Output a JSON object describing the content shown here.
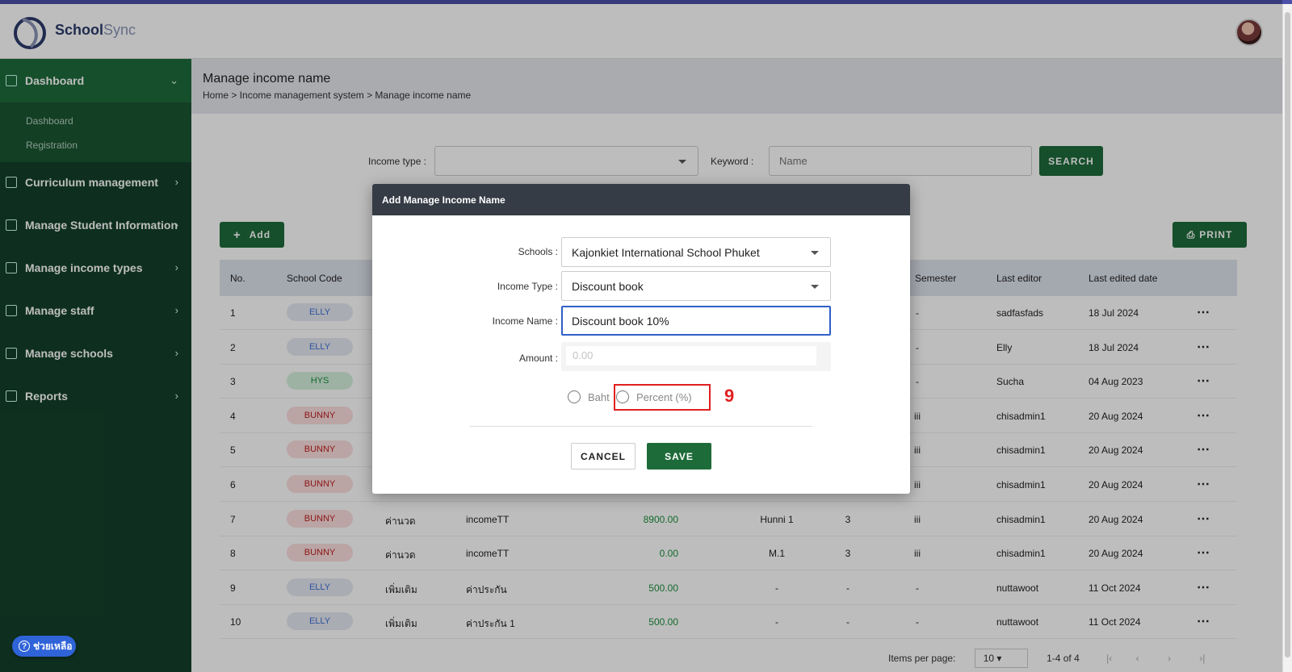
{
  "app": {
    "brand_main": "School",
    "brand_accent": "Sync"
  },
  "sidebar": {
    "items": [
      {
        "label": "Dashboard",
        "icon": "grid-icon"
      },
      {
        "label": "Curriculum management",
        "icon": "graduation-cap-icon"
      },
      {
        "label": "Manage Student Information",
        "icon": "student-icon"
      },
      {
        "label": "Manage income types",
        "icon": "money-hand-icon"
      },
      {
        "label": "Manage staff",
        "icon": "id-card-icon"
      },
      {
        "label": "Manage schools",
        "icon": "school-icon"
      },
      {
        "label": "Reports",
        "icon": "report-icon"
      }
    ],
    "sub_items": [
      "Dashboard",
      "Registration"
    ]
  },
  "page": {
    "title": "Manage income name",
    "breadcrumb": "Home > Income management system > Manage income name"
  },
  "filters": {
    "income_type_label": "Income type :",
    "keyword_label": "Keyword :",
    "keyword_placeholder": "Name",
    "search_label": "SEARCH"
  },
  "toolbar": {
    "add_label": "Add",
    "print_label": "PRINT"
  },
  "table": {
    "headers": {
      "no": "No.",
      "school_code": "School Code",
      "semester": "Semester",
      "last_editor": "Last editor",
      "last_edited_date": "Last edited date"
    },
    "rows": [
      {
        "no": "1",
        "code": "ELLY",
        "c3": "",
        "c4": "",
        "amount": "",
        "c6": "",
        "c7": "",
        "semester": "-",
        "editor": "sadfasfads",
        "date": "18 Jul 2024"
      },
      {
        "no": "2",
        "code": "ELLY",
        "c3": "",
        "c4": "",
        "amount": "",
        "c6": "",
        "c7": "",
        "semester": "-",
        "editor": "Elly",
        "date": "18 Jul 2024"
      },
      {
        "no": "3",
        "code": "HYS",
        "c3": "",
        "c4": "",
        "amount": "",
        "c6": "",
        "c7": "",
        "semester": "-",
        "editor": "Sucha",
        "date": "04 Aug 2023"
      },
      {
        "no": "4",
        "code": "BUNNY",
        "c3": "",
        "c4": "",
        "amount": "",
        "c6": "",
        "c7": "",
        "semester": "iii",
        "editor": "chisadmin1",
        "date": "20 Aug 2024"
      },
      {
        "no": "5",
        "code": "BUNNY",
        "c3": "",
        "c4": "",
        "amount": "",
        "c6": "",
        "c7": "",
        "semester": "iii",
        "editor": "chisadmin1",
        "date": "20 Aug 2024"
      },
      {
        "no": "6",
        "code": "BUNNY",
        "c3": "",
        "c4": "",
        "amount": "",
        "c6": "",
        "c7": "",
        "semester": "iii",
        "editor": "chisadmin1",
        "date": "20 Aug 2024"
      },
      {
        "no": "7",
        "code": "BUNNY",
        "c3": "ค่านวด",
        "c4": "incomeTT",
        "amount": "8900.00",
        "c6": "Hunni 1",
        "c7": "3",
        "semester": "iii",
        "editor": "chisadmin1",
        "date": "20 Aug 2024"
      },
      {
        "no": "8",
        "code": "BUNNY",
        "c3": "ค่านวด",
        "c4": "incomeTT",
        "amount": "0.00",
        "c6": "M.1",
        "c7": "3",
        "semester": "iii",
        "editor": "chisadmin1",
        "date": "20 Aug 2024"
      },
      {
        "no": "9",
        "code": "ELLY",
        "c3": "เพิ่มเติม",
        "c4": "ค่าประกัน",
        "amount": "500.00",
        "c6": "-",
        "c7": "-",
        "semester": "-",
        "editor": "nuttawoot",
        "date": "11 Oct 2024"
      },
      {
        "no": "10",
        "code": "ELLY",
        "c3": "เพิ่มเติม",
        "c4": "ค่าประกัน 1",
        "amount": "500.00",
        "c6": "-",
        "c7": "-",
        "semester": "-",
        "editor": "nuttawoot",
        "date": "11 Oct 2024"
      }
    ]
  },
  "pager": {
    "items_per_page_label": "Items per page:",
    "items_per_page": "10",
    "range": "1-4 of 4"
  },
  "modal": {
    "title": "Add Manage Income Name",
    "schools_label": "Schools :",
    "schools_value": "Kajonkiet International School Phuket",
    "income_type_label": "Income Type :",
    "income_type_value": "Discount book",
    "income_name_label": "Income Name :",
    "income_name_value": "Discount book 10%",
    "amount_label": "Amount :",
    "amount_placeholder": "0.00",
    "radio_baht": "Baht",
    "radio_percent": "Percent (%)",
    "annotation_number": "9",
    "cancel_label": "CANCEL",
    "save_label": "SAVE"
  },
  "help": {
    "label": "ช่วยเหลือ"
  },
  "colors": {
    "primary_green": "#1e6b3a",
    "sidebar_bg": "#14402a",
    "annotation_red": "#e02020",
    "modal_header": "#353c46"
  }
}
